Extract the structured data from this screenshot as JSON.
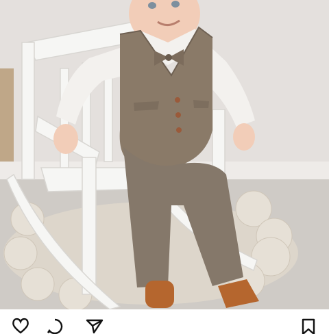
{
  "post": {
    "image_alt": "",
    "actions": {
      "like_icon": "heart-icon",
      "comment_icon": "comment-icon",
      "share_icon": "send-icon",
      "save_icon": "bookmark-icon"
    }
  },
  "colors": {
    "wall": "#e3dfdc",
    "floor": "#cfccc8",
    "rug": "#ded8cf",
    "chair": "#f5f5f3",
    "suit": "#8a7a68",
    "shirt": "#f3f1ee",
    "skin": "#f2cdb8",
    "socks": "#b5662e",
    "icons": "#111111"
  }
}
